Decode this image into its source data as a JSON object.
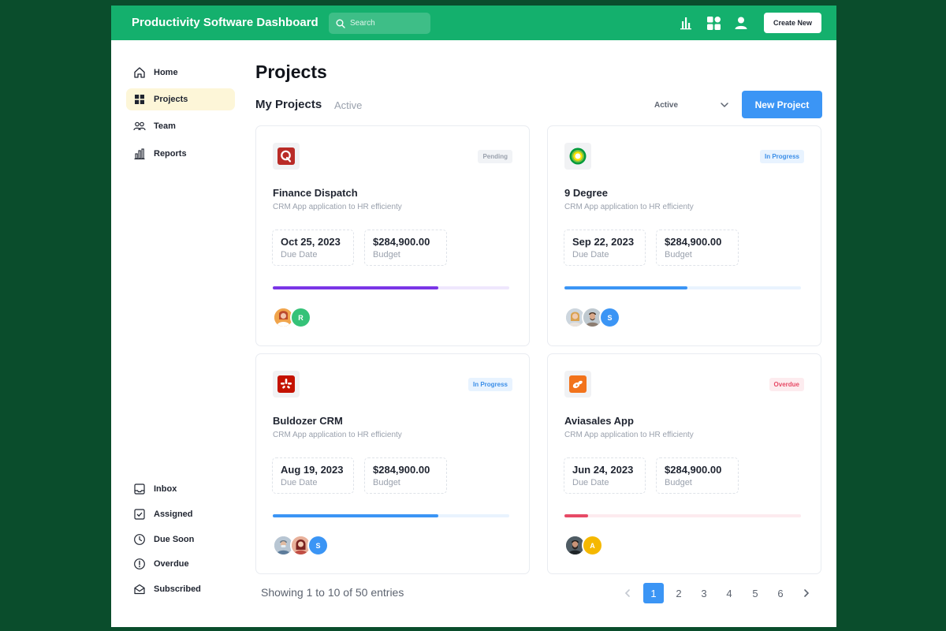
{
  "header": {
    "title": "Productivity Software Dashboard",
    "search_placeholder": "Search",
    "create_label": "Create New",
    "icons": [
      "chart-icon",
      "apps-icon",
      "user-icon"
    ],
    "accent_color": "#14b06d"
  },
  "sidebar": {
    "items": [
      {
        "label": "Home",
        "icon": "home-icon"
      },
      {
        "label": "Projects",
        "icon": "grid-icon",
        "active": true
      },
      {
        "label": "Team",
        "icon": "team-icon"
      },
      {
        "label": "Reports",
        "icon": "bar-chart-icon"
      }
    ],
    "bottom_items": [
      {
        "label": "Inbox",
        "icon": "inbox-icon"
      },
      {
        "label": "Assigned",
        "icon": "checkbox-icon"
      },
      {
        "label": "Due Soon",
        "icon": "clock-icon"
      },
      {
        "label": "Overdue",
        "icon": "alert-icon"
      },
      {
        "label": "Subscribed",
        "icon": "envelope-icon"
      }
    ]
  },
  "main": {
    "title": "Projects",
    "section_title": "My Projects",
    "section_filter": "Active",
    "status_select": "Active",
    "new_project_label": "New Project",
    "primary_color": "#3b95f5"
  },
  "projects": [
    {
      "name": "Finance Dispatch",
      "description": "CRM App application to HR efficienty",
      "status": "Pending",
      "due_date": "Oct 25, 2023",
      "due_label": "Due Date",
      "budget": "$284,900.00",
      "budget_label": "Budget",
      "progress": 0.7,
      "progress_color": "#7a35e6",
      "logo": "quora-q-logo",
      "avatars": [
        "photo",
        "R"
      ]
    },
    {
      "name": "9 Degree",
      "description": "CRM App application to HR efficienty",
      "status": "In Progress",
      "due_date": "Sep 22, 2023",
      "due_label": "Due Date",
      "budget": "$284,900.00",
      "budget_label": "Budget",
      "progress": 0.52,
      "progress_color": "#3b95f5",
      "logo": "bp-sunflower-logo",
      "avatars": [
        "photo",
        "photo",
        "S"
      ]
    },
    {
      "name": "Buldozer CRM",
      "description": "CRM App application to HR efficienty",
      "status": "In Progress",
      "due_date": "Aug 19, 2023",
      "due_label": "Due Date",
      "budget": "$284,900.00",
      "budget_label": "Budget",
      "progress": 0.7,
      "progress_color": "#3b95f5",
      "logo": "yelp-logo",
      "avatars": [
        "photo",
        "photo",
        "S"
      ]
    },
    {
      "name": "Aviasales App",
      "description": "CRM App application to HR efficienty",
      "status": "Overdue",
      "due_date": "Jun 24, 2023",
      "due_label": "Due Date",
      "budget": "$284,900.00",
      "budget_label": "Budget",
      "progress": 0.1,
      "progress_color": "#e74a66",
      "logo": "aviasales-logo",
      "avatars": [
        "photo",
        "A"
      ]
    }
  ],
  "pagination": {
    "summary": "Showing 1 to 10 of 50 entries",
    "pages": [
      "1",
      "2",
      "3",
      "4",
      "5",
      "6"
    ],
    "current": "1"
  }
}
